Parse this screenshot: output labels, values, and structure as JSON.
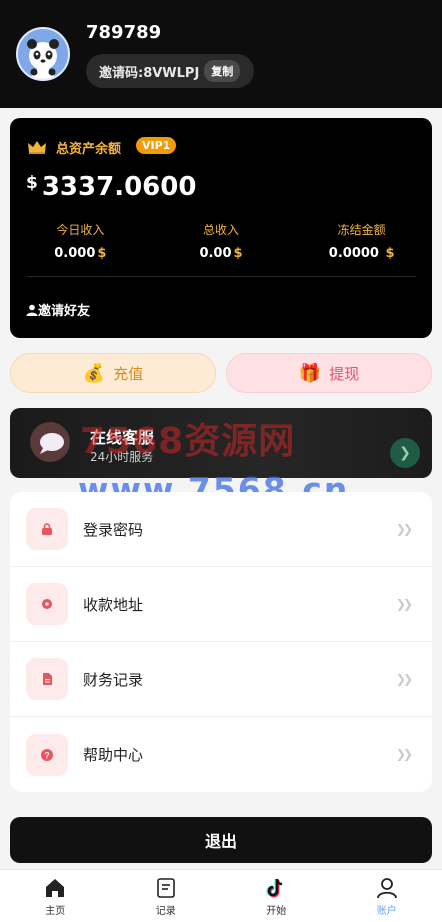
{
  "header": {
    "username": "789789",
    "invite_text": "邀请码:8VWLPJ",
    "copy_label": "复制"
  },
  "asset": {
    "title": "总资产余额",
    "vip": "VIP1",
    "currency_symbol": "$",
    "balance": "3337.0600",
    "stats": [
      {
        "label": "今日收入",
        "value": "0.000",
        "unit": "$"
      },
      {
        "label": "总收入",
        "value": "0.00",
        "unit": "$"
      },
      {
        "label": "冻结金额",
        "value": "0.0000",
        "unit": "$"
      }
    ],
    "invite_friend": "邀请好友"
  },
  "actions": {
    "recharge_label": "充值",
    "withdraw_label": "提现"
  },
  "service": {
    "title": "在线客服",
    "subtitle": "24小时服务"
  },
  "watermark": {
    "line1": "7568资源网",
    "line2": "www.7568.cn"
  },
  "menu": [
    {
      "label": "登录密码",
      "icon": "lock-icon"
    },
    {
      "label": "收款地址",
      "icon": "location-icon"
    },
    {
      "label": "财务记录",
      "icon": "document-icon"
    },
    {
      "label": "帮助中心",
      "icon": "help-icon"
    }
  ],
  "logout_label": "退出",
  "tabs": [
    {
      "label": "主页",
      "icon": "home-icon"
    },
    {
      "label": "记录",
      "icon": "records-icon"
    },
    {
      "label": "开始",
      "icon": "tiktok-icon"
    },
    {
      "label": "账户",
      "icon": "account-icon",
      "active": true
    }
  ],
  "colors": {
    "gold": "#f2b33c",
    "vip_badge": "#f29a0a",
    "active_tab": "#6aa0f5",
    "menu_icon": "#e8555d"
  }
}
